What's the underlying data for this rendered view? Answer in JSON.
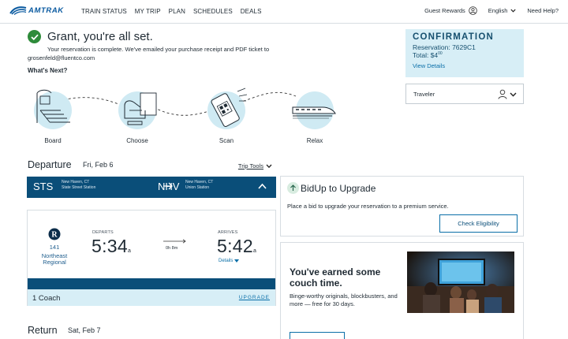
{
  "header": {
    "logo_text": "AMTRAK",
    "nav": [
      "TRAIN STATUS",
      "MY TRIP",
      "PLAN",
      "SCHEDULES",
      "DEALS"
    ],
    "guest_rewards": "Guest Rewards",
    "language": "English",
    "help": "Need Help?"
  },
  "success": {
    "title": "Grant, you're all set.",
    "message": "Your reservation is complete. We've emailed your purchase receipt and PDF ticket to",
    "email": "grosenfeld@fluentco.com"
  },
  "whats_next": {
    "title": "What's Next?",
    "steps": [
      "Board",
      "Choose",
      "Scan",
      "Relax"
    ]
  },
  "confirmation": {
    "title": "CONFIRMATION",
    "reservation": "Reservation: 7629C1",
    "total": "Total: $4",
    "total_cents": "00",
    "view_details": "View Details"
  },
  "traveler": {
    "label": "Traveler"
  },
  "departure": {
    "label": "Departure",
    "date": "Fri, Feb 6",
    "trip_tools": "Trip Tools",
    "origin_code": "STS",
    "origin_city": "New Haven, CT",
    "origin_station": "State Street Station",
    "dest_code": "NHV",
    "dest_city": "New Haven, CT",
    "dest_station": "Union Station",
    "train_number": "141",
    "train_name": "Northeast Regional",
    "departs_label": "DEPARTS",
    "depart_time": "5:34",
    "depart_suffix": "a",
    "duration": "0h 8m",
    "arrives_label": "ARRIVES",
    "arrive_time": "5:42",
    "arrive_suffix": "a",
    "details": "Details",
    "coach": "1 Coach",
    "upgrade": "UPGRADE"
  },
  "bidup": {
    "title": "BidUp to Upgrade",
    "text": "Place a bid to upgrade your reservation to a premium service.",
    "button": "Check Eligibility"
  },
  "promo": {
    "heading": "You've earned some couch time.",
    "text": "Binge-worthy originals, blockbusters, and more — free for 30 days."
  },
  "return": {
    "label": "Return",
    "date": "Sat, Feb 7"
  },
  "colors": {
    "brand_blue": "#0a4e79",
    "link_blue": "#0a6fa8",
    "light_blue": "#d7eef6",
    "success_green": "#2e8b3a"
  }
}
